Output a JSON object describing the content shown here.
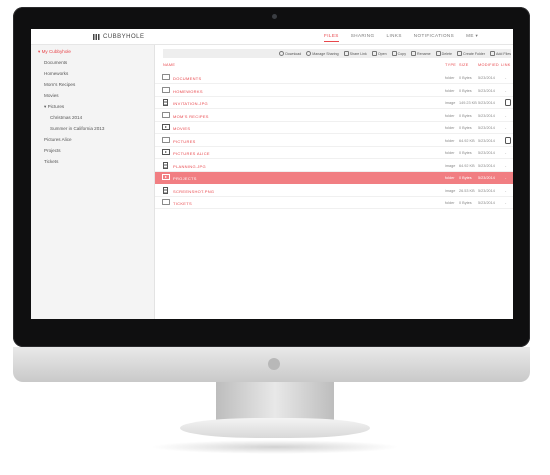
{
  "app": {
    "brand": "CUBBYHOLE",
    "nav": [
      {
        "label": "FILES",
        "active": true
      },
      {
        "label": "SHARING",
        "active": false
      },
      {
        "label": "LINKS",
        "active": false
      },
      {
        "label": "NOTIFICATIONS",
        "active": false
      },
      {
        "label": "ME ▾",
        "active": false
      }
    ]
  },
  "sidebar": {
    "items": [
      {
        "label": "▾ My Cubbyhole",
        "active": true
      },
      {
        "label": "Documents",
        "active": false
      },
      {
        "label": "Homeworks",
        "active": false
      },
      {
        "label": "Mom's Recipes",
        "active": false
      },
      {
        "label": "Movies",
        "active": false
      },
      {
        "label": "▾ Pictures",
        "active": false
      },
      {
        "label": "Christmas 2014",
        "active": false
      },
      {
        "label": "Summer in California 2013",
        "active": false
      },
      {
        "label": "Pictures Alice",
        "active": false
      },
      {
        "label": "Projects",
        "active": false
      },
      {
        "label": "Tickets",
        "active": false
      }
    ]
  },
  "toolbar": {
    "buttons": [
      "Download",
      "Manage Sharing",
      "Share Link",
      "Open",
      "Copy",
      "Rename",
      "Delete",
      "Create Folder",
      "Add Files"
    ]
  },
  "table": {
    "headers": {
      "name": "NAME",
      "type": "TYPE",
      "size": "SIZE",
      "modified": "MODIFIED",
      "link": "LINK"
    },
    "rows": [
      {
        "name": "DOCUMENTS",
        "icon": "folder-icon",
        "type": "folder",
        "size": "0 Bytes",
        "modified": "5/23/2014",
        "link": "-",
        "selected": false
      },
      {
        "name": "HOMEWORKS",
        "icon": "folder-icon",
        "type": "folder",
        "size": "0 Bytes",
        "modified": "5/23/2014",
        "link": "-",
        "selected": false
      },
      {
        "name": "INVITATION.JPG",
        "icon": "file-icon",
        "type": "image",
        "size": "149.23 KB",
        "modified": "5/23/2014",
        "link": "link-badge",
        "selected": false
      },
      {
        "name": "MOM'S RECIPES",
        "icon": "folder-icon",
        "type": "folder",
        "size": "0 Bytes",
        "modified": "5/23/2014",
        "link": "-",
        "selected": false
      },
      {
        "name": "MOVIES",
        "icon": "video-folder-icon",
        "type": "folder",
        "size": "0 Bytes",
        "modified": "5/23/2014",
        "link": "-",
        "selected": false
      },
      {
        "name": "PICTURES",
        "icon": "folder-icon",
        "type": "folder",
        "size": "64.92 KB",
        "modified": "5/23/2014",
        "link": "link-badge",
        "selected": false
      },
      {
        "name": "PICTURES ALICE",
        "icon": "video-folder-icon",
        "type": "folder",
        "size": "0 Bytes",
        "modified": "5/23/2014",
        "link": "-",
        "selected": false
      },
      {
        "name": "PLANNING.JPG",
        "icon": "file-icon",
        "type": "image",
        "size": "64.92 KB",
        "modified": "5/23/2014",
        "link": "-",
        "selected": false
      },
      {
        "name": "PROJECTS",
        "icon": "video-folder-icon",
        "type": "folder",
        "size": "0 Bytes",
        "modified": "5/23/2014",
        "link": "-",
        "selected": true
      },
      {
        "name": "SCREENSHOT.PNG",
        "icon": "file-icon",
        "type": "image",
        "size": "26.53 KB",
        "modified": "5/23/2014",
        "link": "-",
        "selected": false
      },
      {
        "name": "TICKETS",
        "icon": "folder-icon",
        "type": "folder",
        "size": "0 Bytes",
        "modified": "5/23/2014",
        "link": "-",
        "selected": false
      }
    ]
  },
  "colors": {
    "accent": "#e8474c",
    "selected_row": "#f17e82"
  }
}
